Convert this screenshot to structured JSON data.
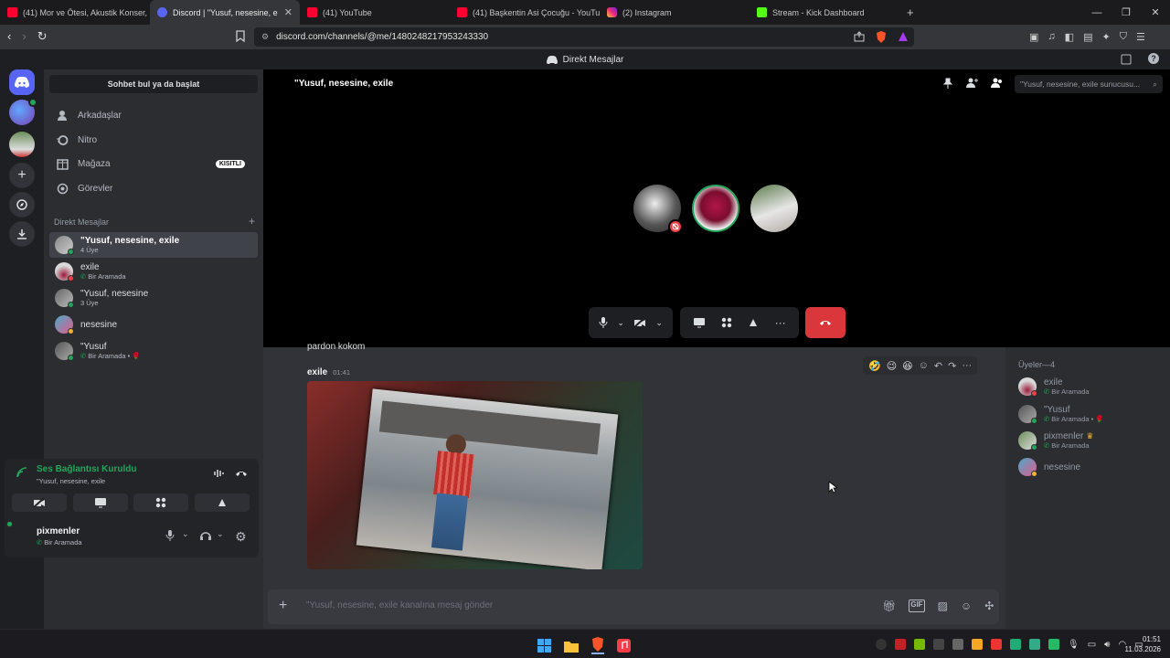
{
  "browser": {
    "tabs": [
      {
        "title": "(41) Mor ve Ötesi, Akustik Konser, Bö",
        "icon": "youtube"
      },
      {
        "title": "Discord | \"Yusuf, nesesine, e",
        "icon": "discord"
      },
      {
        "title": "(41) YouTube",
        "icon": "youtube"
      },
      {
        "title": "(41) Başkentin Asi Çocuğu - YouTube",
        "icon": "youtube"
      },
      {
        "title": "(2) Instagram",
        "icon": "instagram"
      },
      {
        "title": "Stream - Kick Dashboard",
        "icon": "kick"
      }
    ],
    "new_tab": "+",
    "url": "discord.com/channels/@me/1480248217953243330"
  },
  "discord": {
    "top_title": "Direkt Mesajlar",
    "find_button": "Sohbet bul ya da başlat",
    "nav": [
      {
        "label": "Arkadaşlar",
        "icon": "friends-icon"
      },
      {
        "label": "Nitro",
        "icon": "nitro-icon"
      },
      {
        "label": "Mağaza",
        "icon": "shop-icon",
        "badge": "KISITLI"
      },
      {
        "label": "Görevler",
        "icon": "quests-icon"
      }
    ],
    "dm_header": "Direkt Mesajlar",
    "dm_add": "+",
    "dms": [
      {
        "name": "\"Yusuf, nesesine, exile",
        "sub": "4 Üye"
      },
      {
        "name": "exile",
        "sub": "Bir Aramada"
      },
      {
        "name": "\"Yusuf, nesesine",
        "sub": "3 Üye"
      },
      {
        "name": "nesesine",
        "sub": ""
      },
      {
        "name": "\"Yusuf",
        "sub": "Bir Aramada •"
      }
    ],
    "voice": {
      "status": "Ses Bağlantısı Kuruldu",
      "channel": "\"Yusuf, nesesine, exile"
    },
    "user": {
      "name": "pixmenler",
      "status": "Bir Aramada"
    },
    "call": {
      "title": "\"Yusuf, nesesine, exile",
      "search_placeholder": "\"Yusuf, nesesine, exile sunucusu..."
    },
    "chat": {
      "prev_text": "pardon kokom",
      "message_author": "exile",
      "message_time": "01:41",
      "input_placeholder": "\"Yusuf, nesesine, exile kanalına mesaj gönder"
    },
    "members_header": "Üyeler—4",
    "members": [
      {
        "name": "exile",
        "sub": "Bir Aramada"
      },
      {
        "name": "\"Yusuf",
        "sub": "Bir Aramada •"
      },
      {
        "name": "pixmenler",
        "sub": "Bir Aramada"
      },
      {
        "name": "nesesine",
        "sub": ""
      }
    ]
  },
  "taskbar": {
    "time": "01:51",
    "date": "11.03.2026"
  }
}
